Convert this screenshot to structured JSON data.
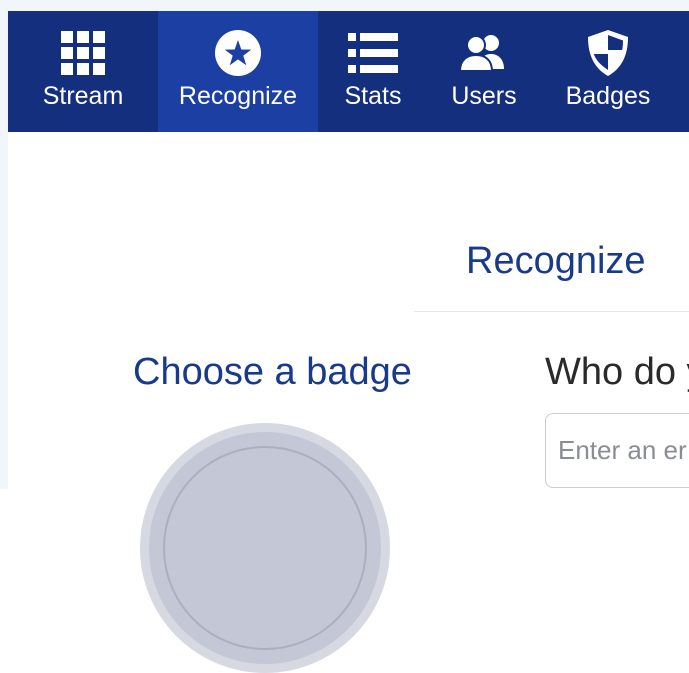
{
  "nav": {
    "items": [
      {
        "label": "Stream",
        "icon": "grid-icon"
      },
      {
        "label": "Recognize",
        "icon": "star-circle-icon",
        "active": true
      },
      {
        "label": "Stats",
        "icon": "list-icon"
      },
      {
        "label": "Users",
        "icon": "users-icon"
      },
      {
        "label": "Badges",
        "icon": "shield-icon"
      }
    ],
    "background_color": "#142f7e",
    "active_color": "#1b3fa3"
  },
  "main": {
    "recognize_title": "Recognize",
    "choose_badge_heading": "Choose a badge",
    "who_heading": "Who do y",
    "email_input": {
      "value": "",
      "placeholder": "Enter an er"
    }
  },
  "colors": {
    "heading_blue": "#183a8c",
    "text_dark": "#2a2a2a",
    "badge_placeholder": "#c3c7d6"
  }
}
